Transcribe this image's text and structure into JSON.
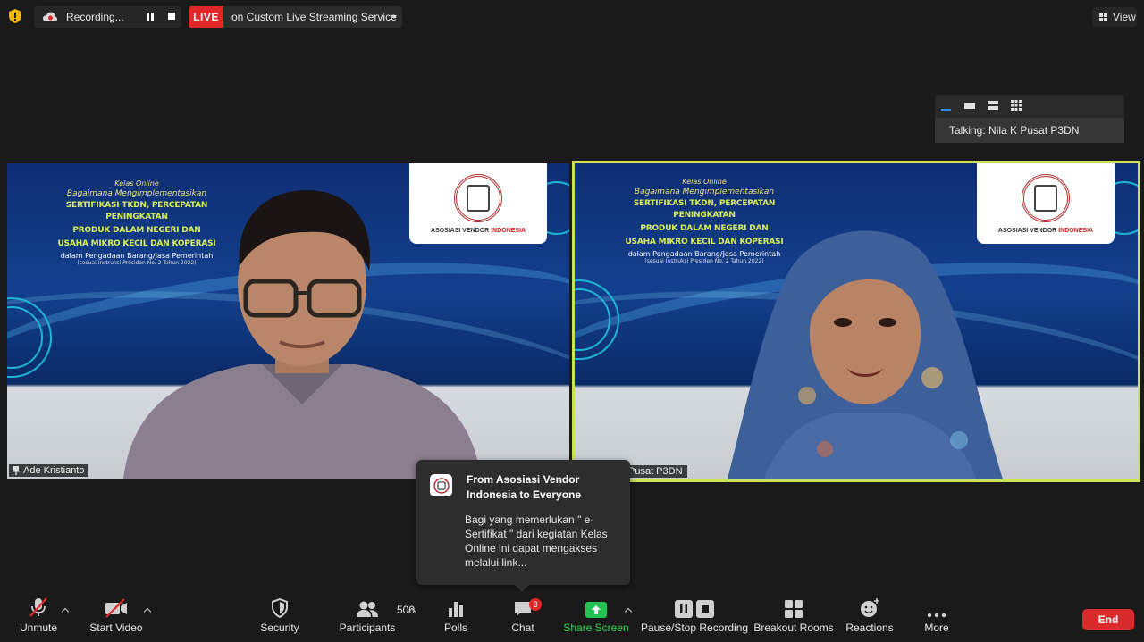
{
  "top_bar": {
    "recording_label": "Recording...",
    "live_badge": "LIVE",
    "live_service": "on Custom Live Streaming Service",
    "view_label": "View"
  },
  "talking_panel": {
    "talking_text": "Talking: Nila K Pusat P3DN"
  },
  "slide": {
    "kelas": "Kelas Online",
    "subtitle": "Bagaimana Mengimplementasikan",
    "line1": "SERTIFIKASI TKDN, PERCEPATAN PENINGKATAN",
    "line2": "PRODUK DALAM NEGERI DAN",
    "line3": "USAHA MIKRO KECIL DAN KOPERASI",
    "line4": "dalam Pengadaan Barang/Jasa Pemerintah",
    "line5": "(sesuai Instruksi Presiden No. 2 Tahun 2022)",
    "logo_text_a": "ASOSIASI VENDOR ",
    "logo_text_b": "INDONESIA"
  },
  "participants": [
    {
      "name": "Ade Kristianto"
    },
    {
      "name": "Pusat P3DN"
    }
  ],
  "chat_popup": {
    "title": "From Asosiasi Vendor Indonesia to Everyone",
    "message": "Bagi yang memerlukan \" e-Sertifikat \" dari kegiatan Kelas Online ini dapat mengakses melalui link..."
  },
  "toolbar": {
    "unmute": "Unmute",
    "start_video": "Start Video",
    "security": "Security",
    "participants": "Participants",
    "participants_count": "500",
    "polls": "Polls",
    "chat": "Chat",
    "chat_badge": "3",
    "share_screen": "Share Screen",
    "pause_stop_recording": "Pause/Stop Recording",
    "breakout_rooms": "Breakout Rooms",
    "reactions": "Reactions",
    "more": "More",
    "end": "End"
  },
  "colors": {
    "live_red": "#e02828",
    "share_green": "#23c552",
    "active_speaker_border": "#c9e25a",
    "end_red": "#d92b2b"
  }
}
